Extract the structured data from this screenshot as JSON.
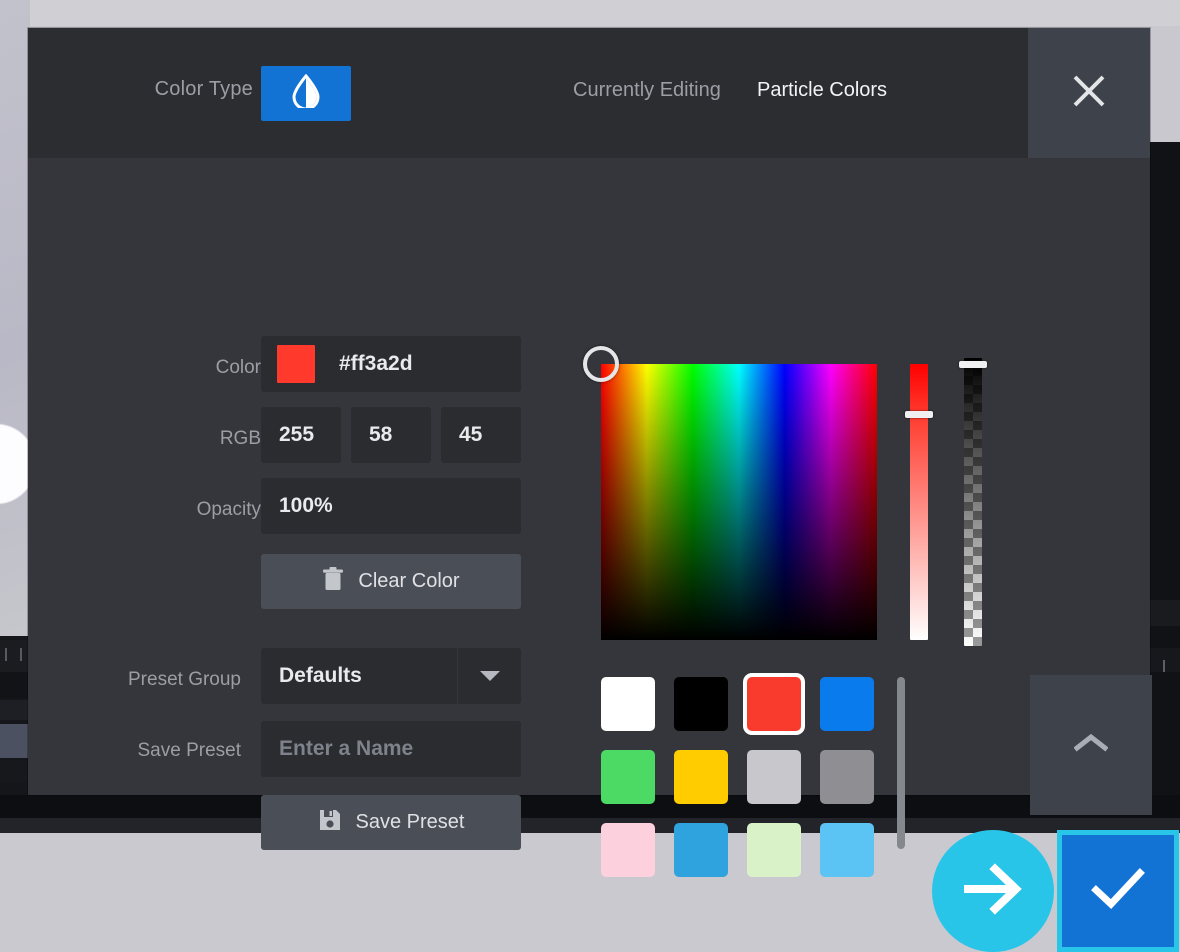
{
  "background": {
    "scene_name": "editor-behind-modal"
  },
  "header": {
    "color_type_label": "Color Type",
    "color_type_icon": "droplet-opacity-icon",
    "currently_editing_label": "Currently Editing",
    "currently_editing_value": "Particle Colors",
    "close_icon": "close-icon"
  },
  "form": {
    "color": {
      "label": "Color",
      "hex": "#ff3a2d",
      "swatch_color": "#ff3a2d"
    },
    "rgb": {
      "label": "RGB",
      "r": "255",
      "g": "58",
      "b": "45"
    },
    "opacity": {
      "label": "Opacity",
      "value": "100%"
    },
    "clear_color": {
      "label": "Clear Color",
      "icon": "trash-icon"
    },
    "preset_group": {
      "label": "Preset Group",
      "selected": "Defaults",
      "caret_icon": "chevron-down-icon"
    },
    "save_preset_field": {
      "label": "Save Preset",
      "placeholder": "Enter a Name",
      "value": ""
    },
    "save_preset_button": {
      "label": "Save Preset",
      "icon": "floppy-save-icon"
    }
  },
  "picker": {
    "cursor_icon": "picker-ring-cursor",
    "saturation_slider_name": "saturation-slider",
    "alpha_slider_name": "alpha-slider",
    "hue_stops": [
      "#ff0000",
      "#ffff00",
      "#00ff00",
      "#00ffff",
      "#0000ff",
      "#ff00ff",
      "#ff0000"
    ]
  },
  "swatches": {
    "selected_index": 2,
    "colors": [
      "#ffffff",
      "#000000",
      "#f93b2d",
      "#0a7bed",
      "#4cd964",
      "#ffcc00",
      "#c7c7cc",
      "#8e8e93",
      "#fcd0dc",
      "#2fa3dd",
      "#d9f2c8",
      "#5cc3f5"
    ]
  },
  "actions": {
    "collapse_icon": "chevron-up-icon",
    "confirm_icon": "checkmark-icon",
    "cursor_icon": "arrow-right-icon"
  },
  "colors": {
    "modal_background": "#34363b",
    "header_background": "#2b2d31",
    "accent_blue": "#1273d4",
    "accent_cyan": "#29c5e8",
    "field_background": "#2a2c30",
    "button_background": "#4a4e57",
    "label_text": "#9b9ea4",
    "value_text": "#e9eaec"
  }
}
